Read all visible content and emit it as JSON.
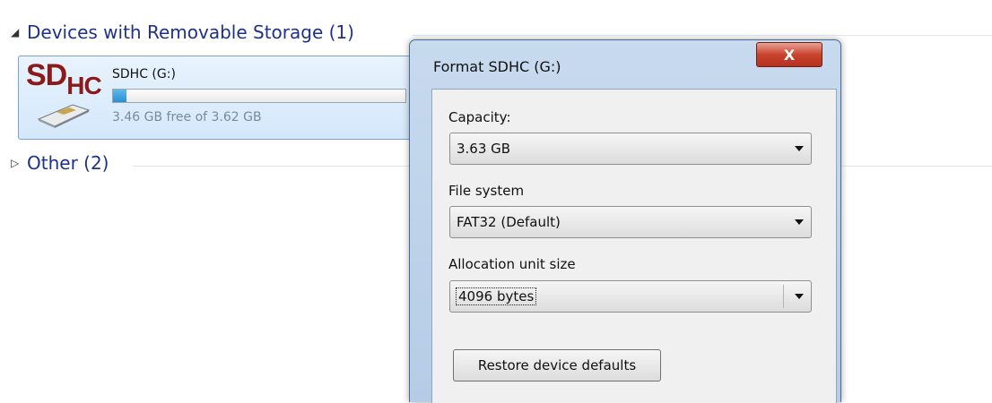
{
  "explorer": {
    "group_removable": "Devices with Removable Storage (1)",
    "group_other": "Other (2)",
    "drive": {
      "badge_sd": "SD",
      "badge_hc": "HC",
      "name": "SDHC (G:)",
      "free_text": "3.46 GB free of 3.62 GB",
      "used_fraction": 0.045
    }
  },
  "dialog": {
    "title": "Format SDHC (G:)",
    "close_glyph": "X",
    "capacity_label": "Capacity:",
    "capacity_value": "3.63 GB",
    "filesystem_label": "File system",
    "filesystem_value": "FAT32 (Default)",
    "alloc_label": "Allocation unit size",
    "alloc_value": "4096 bytes",
    "restore_label": "Restore device defaults"
  },
  "colors": {
    "accent": "#1e3287",
    "close_red": "#c9442d",
    "tile_bg": "#d4e8fb"
  }
}
